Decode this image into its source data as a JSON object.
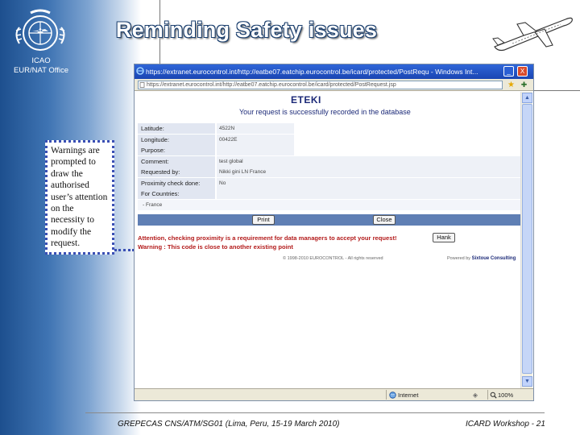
{
  "slide": {
    "title": "Reminding Safety issues",
    "org_label_line1": "ICAO",
    "org_label_line2": "EUR/NAT Office",
    "footer_left": "GREPECAS CNS/ATM/SG01 (Lima, Peru, 15-19 March 2010)",
    "footer_right": "ICARD Workshop - 21"
  },
  "callout": {
    "text": "Warnings are prompted to draw the authorised user’s attention on the necessity to modify the request."
  },
  "browser": {
    "window_title": "https://extranet.eurocontrol.int/http://eatbe07.eatchip.eurocontrol.be/icard/protected/PostRequ - Windows Int...",
    "address": "https://extranet.eurocontrol.int/http://eatbe07.eatchip.eurocontrol.be/icard/protected/PostRequest.jsp",
    "min_label": "_",
    "close_label": "X",
    "status_zone": "Internet",
    "status_zoom": "100%"
  },
  "page": {
    "app_name": "ETEKI",
    "confirm_message": "Your request is successfully recorded in the database",
    "fields": [
      {
        "label": "Latitude:",
        "value": "4522N"
      },
      {
        "label": "Longitude:",
        "value": "00422E"
      },
      {
        "label": "Purpose:",
        "value": ""
      },
      {
        "label": "Comment:",
        "value": "test global"
      },
      {
        "label": "Requested by:",
        "value": "Nikki gini LN France"
      },
      {
        "label": "Proximity check done:",
        "value": "No"
      },
      {
        "label": "For Countries:",
        "value": ""
      }
    ],
    "countries_value": "- France",
    "print_button": "Print",
    "close_button": "Close",
    "warning_line1": "Attention, checking proximity is a requirement for data managers to accept your request!",
    "warning_line2": "Warning : This code is close to another existing point",
    "hank_button": "Hank",
    "copyright": "© 1998-2010 EUROCONTROL - All rights reserved",
    "powered_by_prefix": "Powered by",
    "powered_by_brand": "Sixtoue Consulting"
  }
}
